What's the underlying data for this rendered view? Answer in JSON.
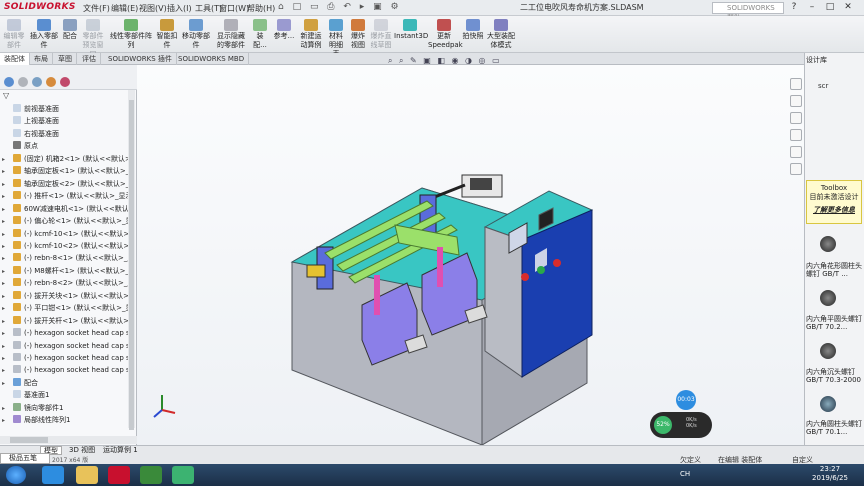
{
  "app": {
    "title": "二工位电吹风寿命机方案.SLDASM",
    "logo": "SOLIDWORKS"
  },
  "menu": [
    "文件(F)",
    "编辑(E)",
    "视图(V)",
    "插入(I)",
    "工具(T)",
    "窗口(W)",
    "帮助(H)"
  ],
  "search": {
    "placeholder": "SOLIDWORKS 帮助"
  },
  "commands": [
    {
      "label": "编辑零部件",
      "disabled": true
    },
    {
      "label": "插入零部件",
      "disabled": false
    },
    {
      "label": "配合",
      "disabled": false
    },
    {
      "label": "零部件预览窗口",
      "disabled": true
    },
    {
      "label": "线性零部件阵列",
      "disabled": false
    },
    {
      "label": "智能扣件",
      "disabled": false
    },
    {
      "label": "移动零部件",
      "disabled": false
    },
    {
      "label": "显示隐藏的零部件",
      "disabled": false
    },
    {
      "label": "装配...",
      "disabled": false
    },
    {
      "label": "参考...",
      "disabled": false
    },
    {
      "label": "新建运动算例",
      "disabled": false
    },
    {
      "label": "材料明细表",
      "disabled": false
    },
    {
      "label": "爆炸视图",
      "disabled": false
    },
    {
      "label": "爆炸直线草图",
      "disabled": true
    },
    {
      "label": "Instant3D",
      "disabled": false
    },
    {
      "label": "更新Speedpak",
      "disabled": false
    },
    {
      "label": "拍快照",
      "disabled": false
    },
    {
      "label": "大型装配体模式",
      "disabled": false
    }
  ],
  "tabs": [
    "装配体",
    "布局",
    "草图",
    "评估",
    "SOLIDWORKS 插件",
    "SOLIDWORKS MBD"
  ],
  "tree": [
    {
      "label": "前视基准面",
      "icon": "plane",
      "arrow": ""
    },
    {
      "label": "上视基准面",
      "icon": "plane",
      "arrow": ""
    },
    {
      "label": "右视基准面",
      "icon": "plane",
      "arrow": ""
    },
    {
      "label": "原点",
      "icon": "origin",
      "arrow": ""
    },
    {
      "label": "(固定) 机箱2<1> (默认<<默认>_显",
      "icon": "part",
      "arrow": "▸"
    },
    {
      "label": "轴承固定板<1> (默认<<默认>_显",
      "icon": "part",
      "arrow": "▸"
    },
    {
      "label": "轴承固定板<2> (默认<<默认>_显",
      "icon": "part",
      "arrow": "▸"
    },
    {
      "label": "(-) 推杆<1> (默认<<默认>_显示状",
      "icon": "part",
      "arrow": "▸"
    },
    {
      "label": "60W减速电机<1> (默认<<默认>_",
      "icon": "part",
      "arrow": "▸"
    },
    {
      "label": "(-) 偏心轮<1> (默认<<默认>_显",
      "icon": "part",
      "arrow": "▸"
    },
    {
      "label": "(-) kcmf-10<1> (默认<<默认>_显",
      "icon": "part",
      "arrow": "▸"
    },
    {
      "label": "(-) kcmf-10<2> (默认<<默认>_显",
      "icon": "part",
      "arrow": "▸"
    },
    {
      "label": "(-) rebn-8<1> (默认<<默认>_显",
      "icon": "part",
      "arrow": "▸"
    },
    {
      "label": "(-) M8螺杆<1> (默认<<默认>_显",
      "icon": "part",
      "arrow": "▸"
    },
    {
      "label": "(-) rebn-8<2> (默认<<默认>_显",
      "icon": "part",
      "arrow": "▸"
    },
    {
      "label": "(-) 拔开关块<1> (默认<<默认>_显",
      "icon": "part",
      "arrow": "▸"
    },
    {
      "label": "(-) 平口钳<1> (默认<<默认>_显示",
      "icon": "part",
      "arrow": "▸"
    },
    {
      "label": "(-) 拔开关杆<1> (默认<<默认>_显",
      "icon": "part",
      "arrow": "▸"
    },
    {
      "label": "(-) hexagon socket head cap scre",
      "icon": "screw",
      "arrow": "▸"
    },
    {
      "label": "(-) hexagon socket head cap scre",
      "icon": "screw",
      "arrow": "▸"
    },
    {
      "label": "(-) hexagon socket head cap scre",
      "icon": "screw",
      "arrow": "▸"
    },
    {
      "label": "(-) hexagon socket head cap scre",
      "icon": "screw",
      "arrow": "▸"
    },
    {
      "label": "配合",
      "icon": "mate",
      "arrow": "▸"
    },
    {
      "label": "基准面1",
      "icon": "plane",
      "arrow": ""
    },
    {
      "label": "镜向零部件1",
      "icon": "mirror",
      "arrow": "▸"
    },
    {
      "label": "局部线性阵列1",
      "icon": "pattern",
      "arrow": "▸"
    }
  ],
  "rtask": {
    "title": "设计库",
    "sc_label": "scr"
  },
  "toolbox": {
    "line1": "Toolbox",
    "line2": "目前未激活设计",
    "link": "了解更多信息"
  },
  "parts": [
    {
      "name": "内六角花形圆柱头螺钉 GB/T ..."
    },
    {
      "name": "内六角平圆头螺钉 GB/T 70.2..."
    },
    {
      "name": "内六角沉头螺钉 GB/T 70.3-2000"
    },
    {
      "name": "内六角圆柱头螺钉 GB/T 70.1..."
    }
  ],
  "bottom_tabs": [
    "模型",
    "3D 视图",
    "运动算例 1"
  ],
  "status": {
    "left": "2017 x64 版",
    "right1": "欠定义",
    "right2": "在编辑 装配体",
    "right3": "自定义"
  },
  "lang_bar": "极品五笔",
  "overlay": {
    "timer": "00:03",
    "net_pct": "52%",
    "net_up": "0K/s",
    "net_down": "0K/s"
  },
  "tray": "CH",
  "clock": {
    "time": "23:27",
    "date": "2019/6/25"
  },
  "colors": {
    "chassis": "#b8bbc4",
    "top_panel": "#39c6c3",
    "control_box": "#1a3fb0",
    "rails": "#9be06a",
    "clamps": "#8b7fe8"
  }
}
